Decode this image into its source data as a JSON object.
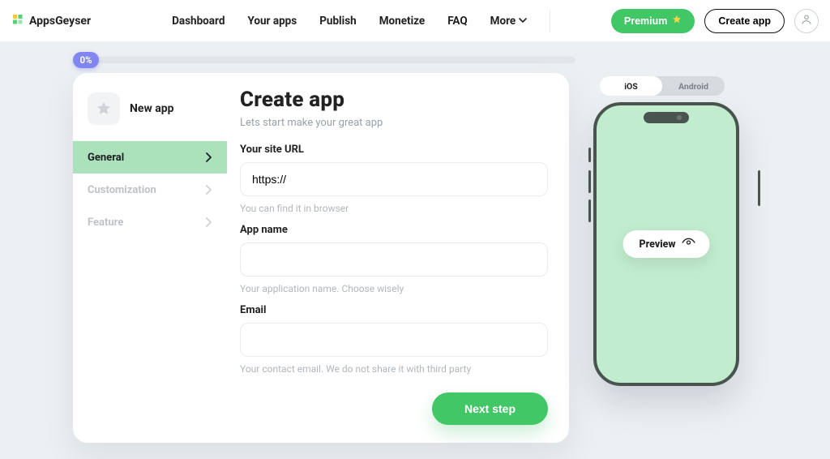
{
  "brand": {
    "name": "AppsGeyser"
  },
  "nav": {
    "items": [
      "Dashboard",
      "Your apps",
      "Publish",
      "Monetize",
      "FAQ"
    ],
    "more_label": "More"
  },
  "header_actions": {
    "premium": "Premium",
    "create_app": "Create app"
  },
  "progress": {
    "percent_label": "0%"
  },
  "builder": {
    "new_app_label": "New app",
    "side_items": [
      {
        "label": "General",
        "active": true
      },
      {
        "label": "Customization",
        "active": false
      },
      {
        "label": "Feature",
        "active": false
      }
    ],
    "title": "Create app",
    "subtitle": "Lets start make your great app",
    "fields": {
      "url": {
        "label": "Your site URL",
        "value": "https://",
        "hint": "You can find it in browser"
      },
      "name": {
        "label": "App name",
        "value": "",
        "hint": "Your application name. Choose wisely"
      },
      "email": {
        "label": "Email",
        "value": "",
        "hint": "Your contact email. We do not share it with third party"
      }
    },
    "next_label": "Next step"
  },
  "preview": {
    "platforms": {
      "ios": "iOS",
      "android": "Android",
      "active": "ios"
    },
    "chip_label": "Preview"
  }
}
